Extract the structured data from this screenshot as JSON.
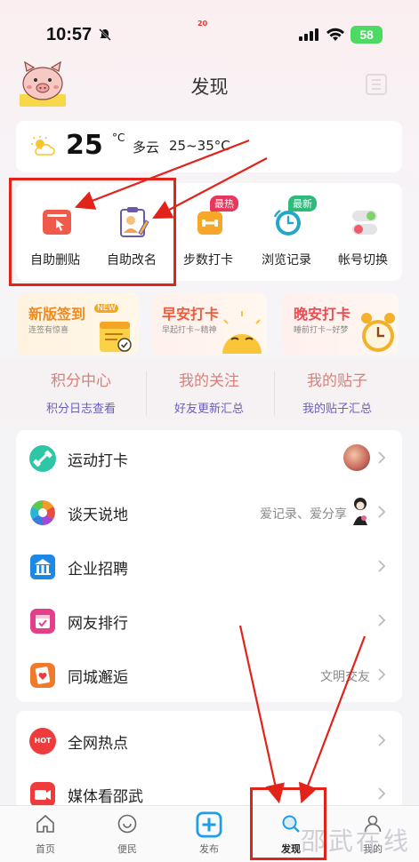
{
  "status_bar": {
    "time": "10:57",
    "center_text": "20",
    "battery": "58"
  },
  "header": {
    "title": "发现"
  },
  "weather": {
    "temp": "25",
    "unit": "°C",
    "condition": "多云",
    "range": "25~35°C"
  },
  "tools": [
    {
      "label": "自助删贴",
      "icon": "delete-post-icon"
    },
    {
      "label": "自助改名",
      "icon": "rename-icon"
    },
    {
      "label": "步数打卡",
      "icon": "dumbbell-icon",
      "badge": "最热"
    },
    {
      "label": "浏览记录",
      "icon": "history-clock-icon",
      "badge": "最新"
    },
    {
      "label": "帐号切换",
      "icon": "toggle-switch-icon"
    }
  ],
  "promos": [
    {
      "title": "新版签到",
      "tag": "NEW",
      "sub": "连签有惊喜"
    },
    {
      "title": "早安打卡",
      "sub": "早起打卡~精神"
    },
    {
      "title": "晚安打卡",
      "sub": "睡前打卡~好梦"
    }
  ],
  "columns": [
    {
      "title": "积分中心",
      "sub": "积分日志查看"
    },
    {
      "title": "我的关注",
      "sub": "好友更新汇总"
    },
    {
      "title": "我的贴子",
      "sub": "我的贴子汇总"
    }
  ],
  "list": [
    {
      "label": "运动打卡",
      "extra": "",
      "icon": "sport-icon",
      "color": "#2fc6a5"
    },
    {
      "label": "谈天说地",
      "extra": "爱记录、爱分享",
      "icon": "aperture-icon",
      "color": "#f39a2b"
    },
    {
      "label": "企业招聘",
      "extra": "",
      "icon": "company-icon",
      "color": "#1e88e5"
    },
    {
      "label": "网友排行",
      "extra": "",
      "icon": "calendar-icon",
      "color": "#e53e8a"
    },
    {
      "label": "同城邂逅",
      "extra": "文明交友",
      "icon": "heart-card-icon",
      "color": "#f07a2a"
    }
  ],
  "list2": [
    {
      "label": "全网热点",
      "icon": "hot-icon",
      "color": "#ef3b3b",
      "icon_text": "HOT"
    },
    {
      "label": "媒体看邵武",
      "icon": "video-camera-icon",
      "color": "#ef3b3b"
    }
  ],
  "nav": [
    {
      "label": "首页",
      "icon": "home-icon"
    },
    {
      "label": "便民",
      "icon": "convenience-icon"
    },
    {
      "label": "发布",
      "icon": "publish-plus-icon"
    },
    {
      "label": "发现",
      "icon": "discover-search-icon"
    },
    {
      "label": "我的",
      "icon": "profile-icon"
    }
  ],
  "watermark": "邵武在线",
  "colors": {
    "annotation_red": "#e2231a",
    "publish_blue": "#1f9ee8"
  }
}
